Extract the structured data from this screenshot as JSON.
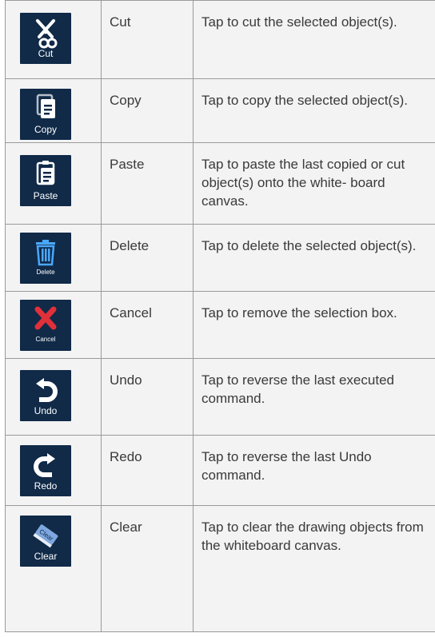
{
  "rows": [
    {
      "icon": "scissors-icon",
      "icon_label": "Cut",
      "name": "Cut",
      "description": "Tap to cut the selected object(s)."
    },
    {
      "icon": "copy-icon",
      "icon_label": "Copy",
      "name": "Copy",
      "description": "Tap to copy the selected object(s)."
    },
    {
      "icon": "paste-icon",
      "icon_label": "Paste",
      "name": "Paste",
      "description": "Tap to paste the last copied or cut object(s) onto the white- board canvas."
    },
    {
      "icon": "trash-icon",
      "icon_label": "Delete",
      "name": "Delete",
      "description": "Tap to delete the selected object(s)."
    },
    {
      "icon": "cancel-x-icon",
      "icon_label": "Cancel",
      "name": "Cancel",
      "description": "Tap to remove the selection box."
    },
    {
      "icon": "undo-arrow-icon",
      "icon_label": "Undo",
      "name": "Undo",
      "description": "Tap to reverse the last executed command."
    },
    {
      "icon": "redo-arrow-icon",
      "icon_label": "Redo",
      "name": "Redo",
      "description": "Tap to reverse the last Undo command."
    },
    {
      "icon": "eraser-icon",
      "icon_label": "Clear",
      "icon_label_overlay": "Clear",
      "name": "Clear",
      "description": "Tap to clear the drawing objects from the whiteboard canvas."
    }
  ],
  "colors": {
    "icon_background": "#102a48",
    "icon_glyph": "#ffffff",
    "cancel_red": "#e0303a",
    "eraser_blue": "#7fa8e0",
    "cell_background": "#f3f3f3",
    "border": "#9a9a9a"
  }
}
